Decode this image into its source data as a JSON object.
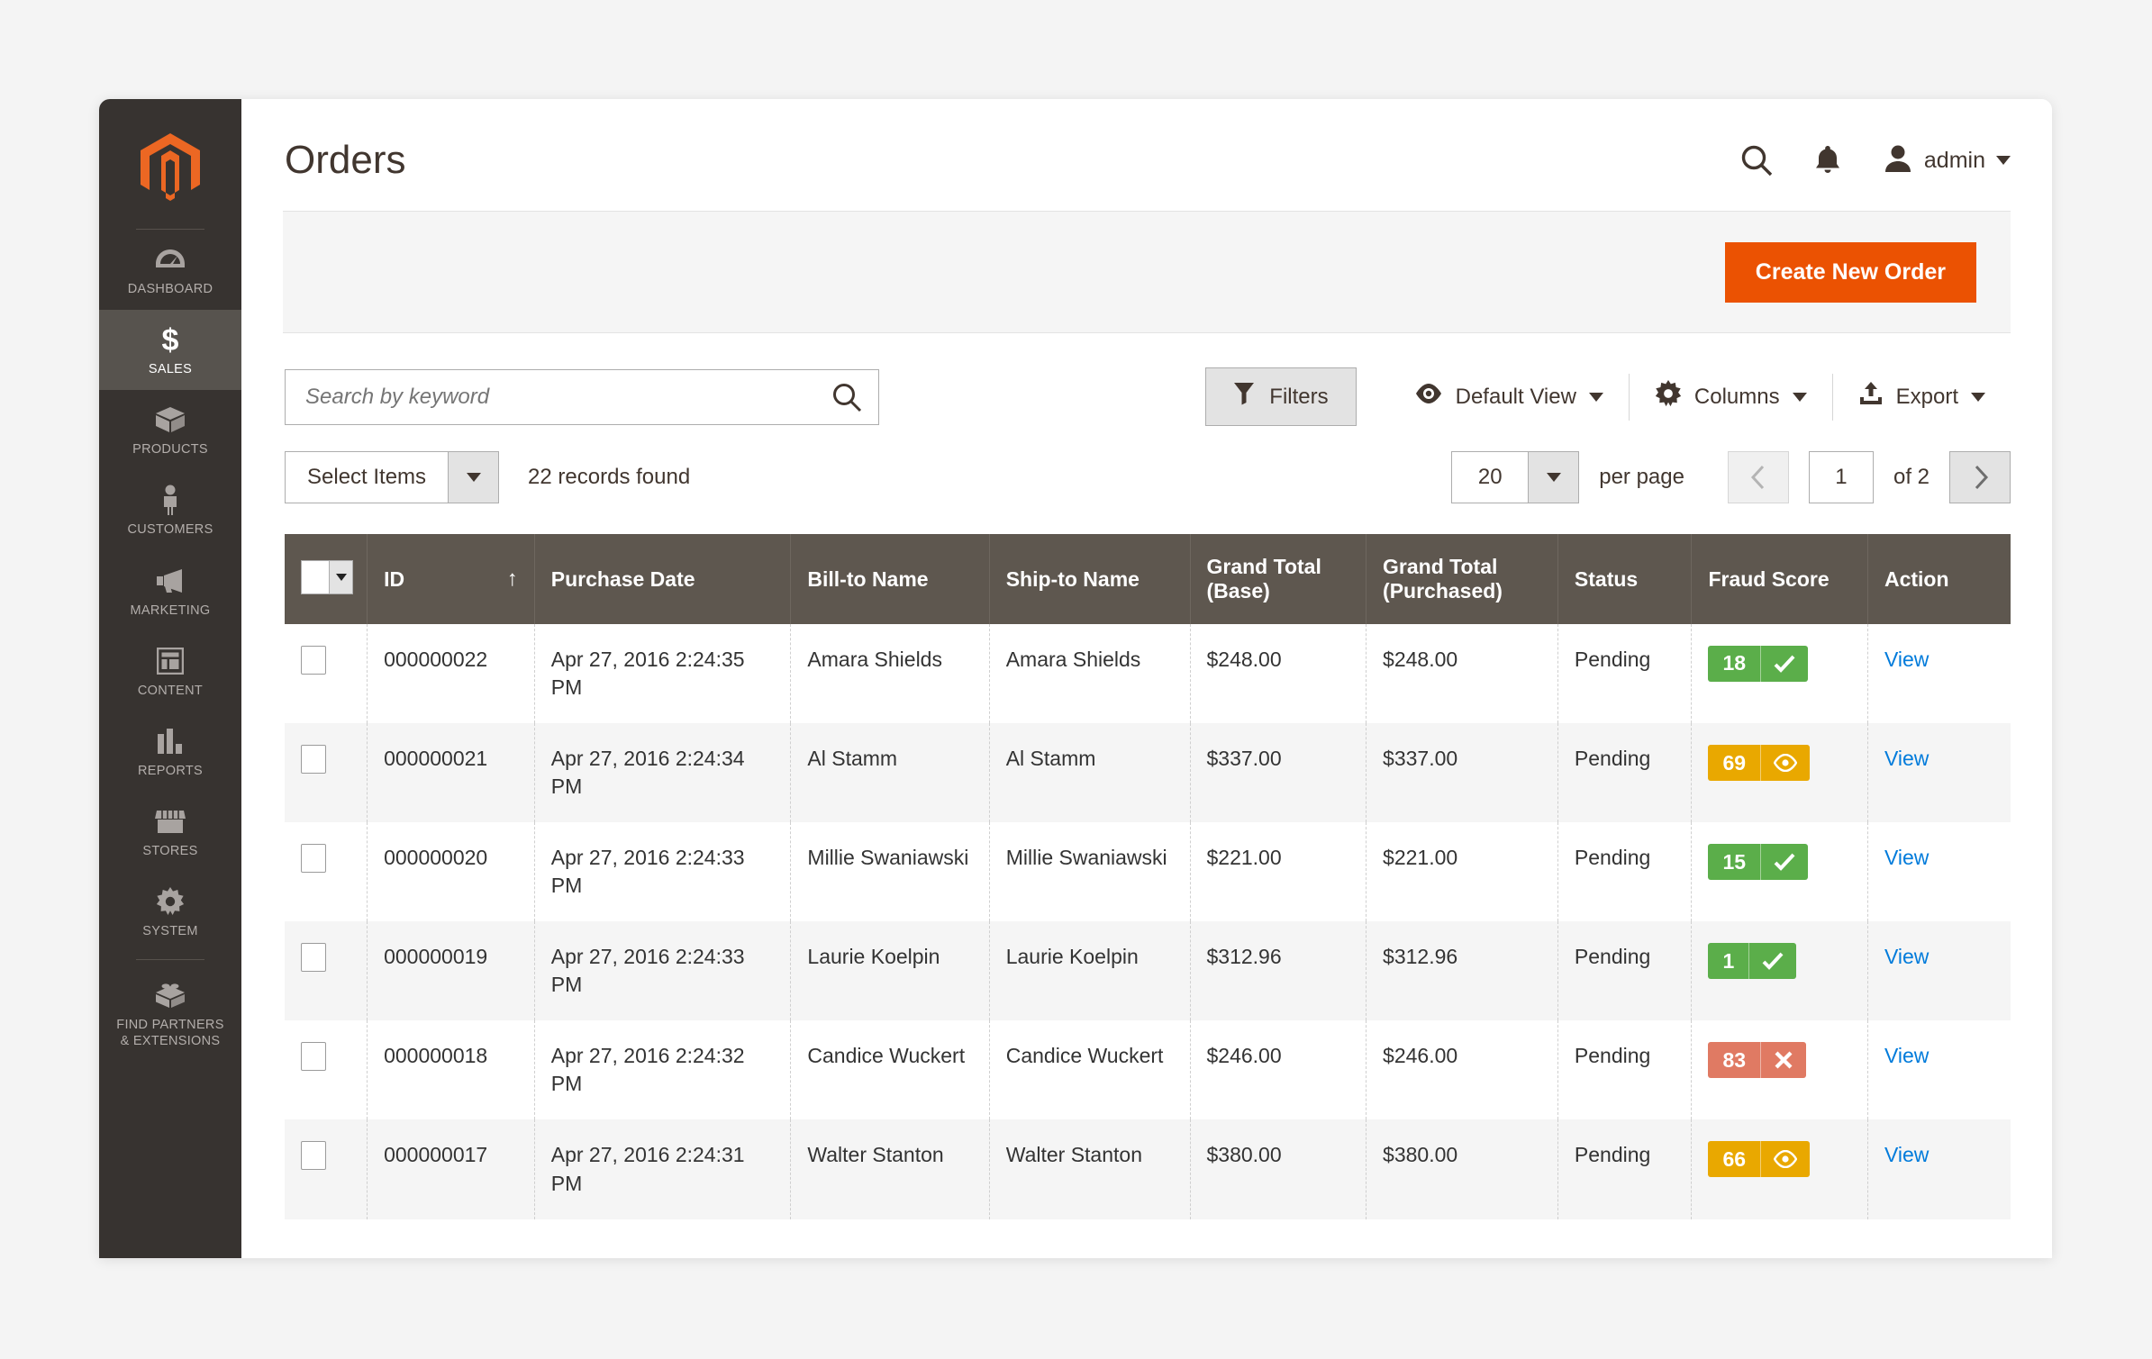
{
  "colors": {
    "accent": "#eb5202",
    "sidebar_bg": "#373330",
    "sidebar_active": "#57534e",
    "table_header_bg": "#5e574f",
    "link": "#007bdb",
    "badge_green": "#5bae4a",
    "badge_amber": "#e9a800",
    "badge_red": "#e07a63"
  },
  "sidebar": {
    "logo_icon": "magento-logo-icon",
    "items": [
      {
        "label": "DASHBOARD",
        "icon": "dashboard-gauge-icon",
        "active": false
      },
      {
        "label": "SALES",
        "icon": "dollar-sign-icon",
        "active": true
      },
      {
        "label": "PRODUCTS",
        "icon": "box-icon",
        "active": false
      },
      {
        "label": "CUSTOMERS",
        "icon": "person-icon",
        "active": false
      },
      {
        "label": "MARKETING",
        "icon": "megaphone-icon",
        "active": false
      },
      {
        "label": "CONTENT",
        "icon": "layout-icon",
        "active": false
      },
      {
        "label": "REPORTS",
        "icon": "bar-chart-icon",
        "active": false
      },
      {
        "label": "STORES",
        "icon": "storefront-icon",
        "active": false
      },
      {
        "label": "SYSTEM",
        "icon": "gear-icon",
        "active": false
      },
      {
        "label": "FIND PARTNERS\n& EXTENSIONS",
        "icon": "lego-brick-icon",
        "active": false
      }
    ],
    "partners_line1": "FIND PARTNERS",
    "partners_line2": "& EXTENSIONS"
  },
  "header": {
    "title": "Orders",
    "search_icon": "search-icon",
    "notifications_icon": "bell-icon",
    "avatar_icon": "user-avatar-icon",
    "admin_label": "admin",
    "admin_caret": "chevron-down-icon"
  },
  "action_bar": {
    "create_order_label": "Create New Order"
  },
  "toolbar": {
    "search_placeholder": "Search by keyword",
    "search_value": "",
    "search_icon": "search-icon",
    "filters_label": "Filters",
    "filters_icon": "funnel-icon",
    "view_label": "Default View",
    "view_icon": "eye-icon",
    "columns_label": "Columns",
    "columns_icon": "gear-icon",
    "export_label": "Export",
    "export_icon": "export-upload-icon"
  },
  "subbar": {
    "select_items_label": "Select Items",
    "records_found": "22 records found",
    "per_page_value": "20",
    "per_page_label": "per page",
    "prev_icon": "chevron-left-icon",
    "next_icon": "chevron-right-icon",
    "page_value": "1",
    "page_of": "of 2"
  },
  "table": {
    "columns": [
      "",
      "ID",
      "Purchase Date",
      "Bill-to Name",
      "Ship-to Name",
      "Grand Total (Base)",
      "Grand Total (Purchased)",
      "Status",
      "Fraud Score",
      "Action"
    ],
    "grand_total_base_line1": "Grand Total",
    "grand_total_base_line2": "(Base)",
    "grand_total_purchased_line1": "Grand Total",
    "grand_total_purchased_line2": "(Purchased)",
    "id_header": "ID",
    "sort_indicator": "↑",
    "purchase_date_header": "Purchase Date",
    "bill_to_header": "Bill-to Name",
    "ship_to_header": "Ship-to Name",
    "status_header": "Status",
    "fraud_header": "Fraud Score",
    "action_header": "Action",
    "action_label": "View",
    "rows": [
      {
        "id": "000000022",
        "purchase_date": "Apr 27, 2016 2:24:35 PM",
        "bill_to": "Amara Shields",
        "ship_to": "Amara Shields",
        "grand_total_base": "$248.00",
        "grand_total_purchased": "$248.00",
        "status": "Pending",
        "fraud_score": "18",
        "fraud_level": "green",
        "fraud_icon": "check-icon",
        "action": "View"
      },
      {
        "id": "000000021",
        "purchase_date": "Apr 27, 2016 2:24:34 PM",
        "bill_to": "Al Stamm",
        "ship_to": "Al Stamm",
        "grand_total_base": "$337.00",
        "grand_total_purchased": "$337.00",
        "status": "Pending",
        "fraud_score": "69",
        "fraud_level": "amber",
        "fraud_icon": "eye-icon",
        "action": "View"
      },
      {
        "id": "000000020",
        "purchase_date": "Apr 27, 2016 2:24:33 PM",
        "bill_to": "Millie Swaniawski",
        "ship_to": "Millie Swaniawski",
        "grand_total_base": "$221.00",
        "grand_total_purchased": "$221.00",
        "status": "Pending",
        "fraud_score": "15",
        "fraud_level": "green",
        "fraud_icon": "check-icon",
        "action": "View"
      },
      {
        "id": "000000019",
        "purchase_date": "Apr 27, 2016 2:24:33 PM",
        "bill_to": "Laurie Koelpin",
        "ship_to": "Laurie Koelpin",
        "grand_total_base": "$312.96",
        "grand_total_purchased": "$312.96",
        "status": "Pending",
        "fraud_score": "1",
        "fraud_level": "green",
        "fraud_icon": "check-icon",
        "action": "View"
      },
      {
        "id": "000000018",
        "purchase_date": "Apr 27, 2016 2:24:32 PM",
        "bill_to": "Candice Wuckert",
        "ship_to": "Candice Wuckert",
        "grand_total_base": "$246.00",
        "grand_total_purchased": "$246.00",
        "status": "Pending",
        "fraud_score": "83",
        "fraud_level": "red",
        "fraud_icon": "close-x-icon",
        "action": "View"
      },
      {
        "id": "000000017",
        "purchase_date": "Apr 27, 2016 2:24:31 PM",
        "bill_to": "Walter Stanton",
        "ship_to": "Walter Stanton",
        "grand_total_base": "$380.00",
        "grand_total_purchased": "$380.00",
        "status": "Pending",
        "fraud_score": "66",
        "fraud_level": "amber",
        "fraud_icon": "eye-icon",
        "action": "View"
      }
    ]
  }
}
